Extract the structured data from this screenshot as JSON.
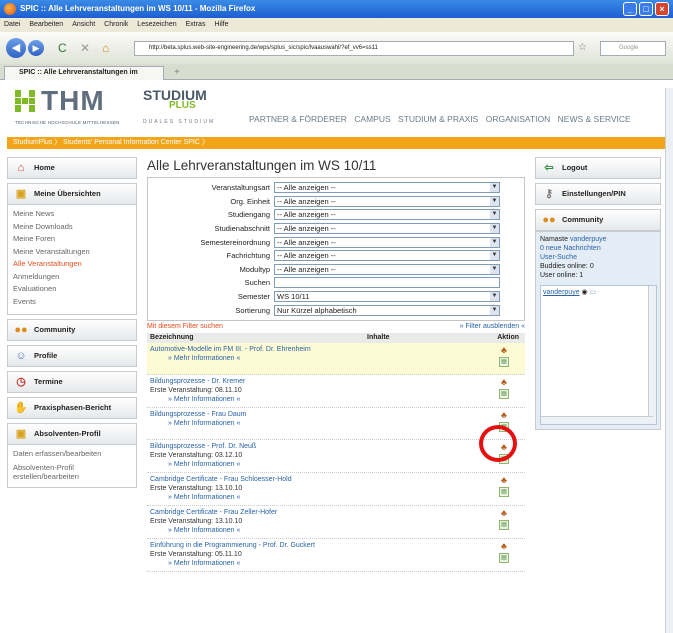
{
  "window": {
    "title": "SPIC :: Alle Lehrveranstaltungen im WS 10/11 - Mozilla Firefox"
  },
  "menubar": [
    "Datei",
    "Bearbeiten",
    "Ansicht",
    "Chronik",
    "Lesezeichen",
    "Extras",
    "Hilfe"
  ],
  "navbar": {
    "url": "http://beta.splus.web-site-engineering.de/wps/splus_sic/spic/lvaauswahl/?ef_vv6=ss11",
    "search_placeholder": "Google"
  },
  "tabs": [
    {
      "label": "SPIC :: Alle Lehrveranstaltungen im"
    }
  ],
  "site": {
    "logo_thm": "THM",
    "logo_thm_sub": "TECHNISCHE HOCHSCHULE MITTELHESSEN",
    "logo_sp1": "STUDIUM",
    "logo_sp2": "PLUS",
    "logo_sp_sub": "DUALES STUDIUM",
    "topnav": [
      "PARTNER & FÖRDERER",
      "CAMPUS",
      "STUDIUM & PRAXIS",
      "ORGANISATION",
      "NEWS & SERVICE"
    ],
    "breadcrumb": "StudiumPlus 〉 Students' Personal Information Center SPIC 〉"
  },
  "sidebar": {
    "home": "Home",
    "overviews": "Meine Übersichten",
    "overview_items": [
      "Meine News",
      "Meine Downloads",
      "Meine Foren",
      "Meine Veranstaltungen",
      "Alle Veranstaltungen",
      "Anmeldungen",
      "Evaluationen",
      "Events"
    ],
    "community": "Community",
    "profile": "Profile",
    "dates": "Termine",
    "internship": "Praxisphasen-Bericht",
    "alumni": "Absolventen-Profil",
    "alumni_items": [
      "Daten erfassen/bearbeiten",
      "Absolventen-Profil erstellen/bearbeiten"
    ]
  },
  "main": {
    "title": "Alle Lehrveranstaltungen im WS 10/11",
    "filters": [
      {
        "label": "Veranstaltungsart",
        "value": "-- Alle anzeigen --"
      },
      {
        "label": "Org. Einheit",
        "value": "-- Alle anzeigen --"
      },
      {
        "label": "Studiengang",
        "value": "-- Alle anzeigen --"
      },
      {
        "label": "Studienabschnitt",
        "value": "-- Alle anzeigen --"
      },
      {
        "label": "Semestereinordnung",
        "value": "-- Alle anzeigen --"
      },
      {
        "label": "Fachrichtung",
        "value": "-- Alle anzeigen --"
      },
      {
        "label": "Modultyp",
        "value": "-- Alle anzeigen --"
      },
      {
        "label": "Suchen",
        "value": ""
      },
      {
        "label": "Semester",
        "value": "WS 10/11"
      },
      {
        "label": "Sortierung",
        "value": "Nur Kürzel alphabetisch"
      }
    ],
    "filter_search": "Mit diesem Filter suchen",
    "filter_hide": "» Filter ausblenden «",
    "columns": [
      "Bezeichnung",
      "Inhalte",
      "Aktion"
    ],
    "more": "» Mehr Informationen «",
    "courses": [
      {
        "title": "Automotive-Modelle im FM III. - Prof. Dr. Ehrenheim",
        "date": ""
      },
      {
        "title": "Bildungsprozesse - Dr. Kremer",
        "date": "Erste Veranstaltung: 08.11.10"
      },
      {
        "title": "Bildungsprozesse - Frau Daum",
        "date": ""
      },
      {
        "title": "Bildungsprozesse - Prof. Dr. Neuß",
        "date": "Erste Veranstaltung: 03.12.10"
      },
      {
        "title": "Cambridge Certificate - Frau Schloesser-Hold",
        "date": "Erste Veranstaltung: 13.10.10"
      },
      {
        "title": "Cambridge Certificate - Frau Zeller-Hofer",
        "date": "Erste Veranstaltung: 13.10.10"
      },
      {
        "title": "Einführung in die Programmierung - Prof. Dr. Guckert",
        "date": "Erste Veranstaltung: 05.11.10"
      }
    ]
  },
  "right": {
    "logout": "Logout",
    "settings": "Einstellungen/PIN",
    "community": "Community",
    "greeting_prefix": "Namaste",
    "username": "vanderpuye",
    "messages": "0 neue Nachrichten",
    "user_search": "User-Suche",
    "buddies": "Buddies online: 0",
    "users_online": "User online: 1"
  }
}
